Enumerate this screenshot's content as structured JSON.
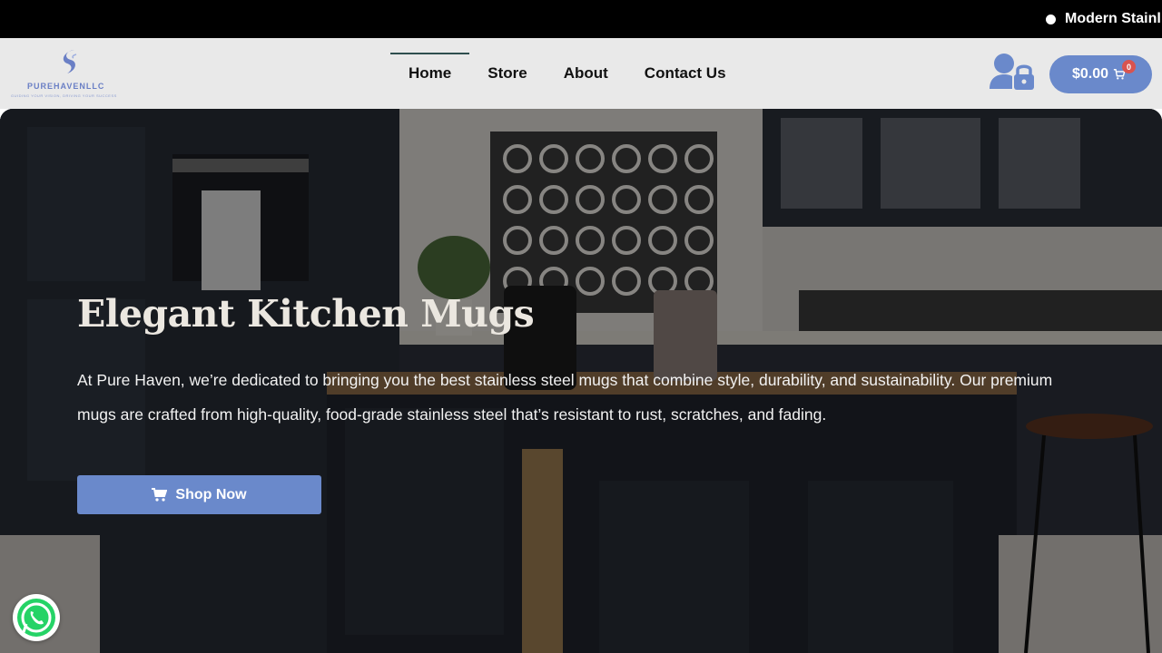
{
  "ticker": {
    "text": "Modern Stainl"
  },
  "logo": {
    "name": "PUREHAVENLLC",
    "tagline": "GUIDING YOUR VISION, DRIVING YOUR SUCCESS"
  },
  "nav": {
    "items": [
      {
        "label": "Home",
        "active": true
      },
      {
        "label": "Store"
      },
      {
        "label": "About"
      },
      {
        "label": "Contact Us"
      }
    ]
  },
  "cart": {
    "amount": "$0.00",
    "count": "0"
  },
  "hero": {
    "title": "Elegant Kitchen Mugs",
    "text": "At Pure Haven, we’re dedicated to bringing you the best stainless steel mugs that combine style, durability, and sustainability. Our premium mugs are crafted from high-quality, food-grade stainless steel that’s resistant to rust, scratches, and fading.",
    "button_label": "Shop Now"
  },
  "colors": {
    "accent": "#6a89cb",
    "ticker_bg": "#000000",
    "header_bg": "#e9e9e9",
    "cart_badge": "#d9534f",
    "whatsapp": "#25d366"
  },
  "icons": {
    "cart": "cart-icon",
    "account": "user-lock-icon",
    "whatsapp": "whatsapp-icon"
  }
}
